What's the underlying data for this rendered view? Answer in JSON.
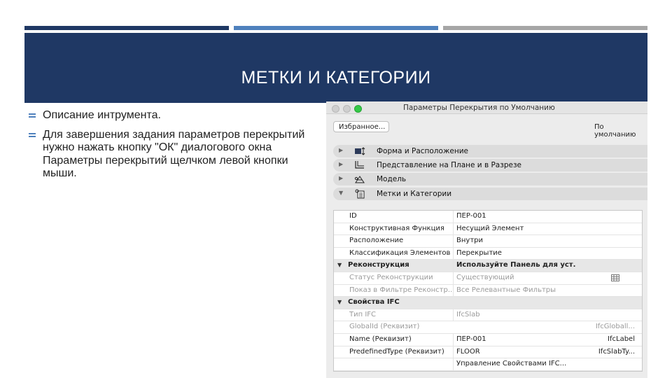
{
  "slide": {
    "title": "МЕТКИ И КАТЕГОРИИ",
    "colors": {
      "dark_navy": "#1f3864",
      "accent_blue": "#4f81bd",
      "gray": "#a6a6a6"
    },
    "bullets": [
      "Описание интрумента.",
      "Для завершения задания параметров перекрытий нужно нажать кнопку \"ОК\" диалогового окна Параметры перекрытий щелчком левой кнопки мыши."
    ]
  },
  "dialog": {
    "title": "Параметры Перекрытия по Умолчанию",
    "favorites_label": "Избранное...",
    "default_label": "По умолчанию",
    "sections": [
      {
        "label": "Форма и Расположение",
        "icon": "slab-shape-icon",
        "expanded": false
      },
      {
        "label": "Представление на Плане и в Разрезе",
        "icon": "floor-plan-icon",
        "expanded": false
      },
      {
        "label": "Модель",
        "icon": "model-icon",
        "expanded": false
      },
      {
        "label": "Метки и Категории",
        "icon": "tag-icon",
        "expanded": true
      }
    ],
    "rows": [
      {
        "type": "row",
        "name": "ID",
        "value": "ПЕР-001",
        "extra": ""
      },
      {
        "type": "row",
        "name": "Конструктивная Функция",
        "value": "Несущий Элемент",
        "extra": ""
      },
      {
        "type": "row",
        "name": "Расположение",
        "value": "Внутри",
        "extra": ""
      },
      {
        "type": "row",
        "name": "Классификация Элементов",
        "value": "Перекрытие",
        "extra": ""
      },
      {
        "type": "head",
        "name": "Реконструкция",
        "value": "Используйте Панель для уст...",
        "extra": ""
      },
      {
        "type": "gray",
        "name": "Статус Реконструкции",
        "value": "Существующий",
        "extra": ""
      },
      {
        "type": "gray",
        "name": "Показ в Фильтре Реконстр...",
        "value": "Все Релевантные Фильтры",
        "extra": ""
      },
      {
        "type": "head",
        "name": "Свойства IFC",
        "value": "",
        "extra": ""
      },
      {
        "type": "gray",
        "name": "Тип IFC",
        "value": "IfcSlab",
        "extra": ""
      },
      {
        "type": "gray",
        "name": "GlobalId (Реквизит)",
        "value": "",
        "extra": "IfcGloball..."
      },
      {
        "type": "row",
        "name": "Name (Реквизит)",
        "value": "ПЕР-001",
        "extra": "IfcLabel"
      },
      {
        "type": "row",
        "name": "PredefinedType (Реквизит)",
        "value": "FLOOR",
        "extra": "IfcSlabTy..."
      },
      {
        "type": "row",
        "name": "",
        "value": "Управление Свойствами IFC...",
        "extra": ""
      }
    ]
  }
}
